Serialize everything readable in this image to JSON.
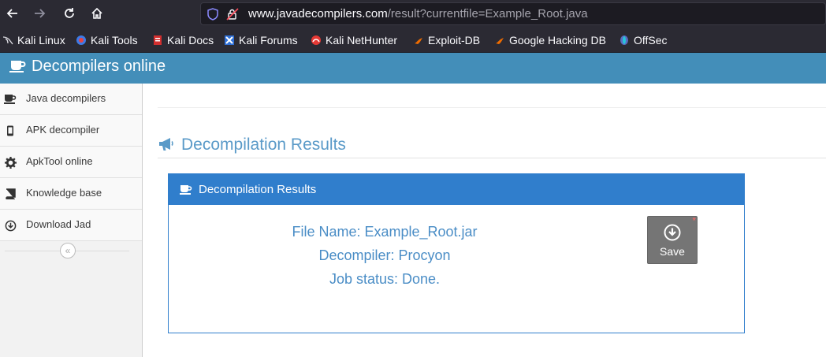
{
  "browser": {
    "url_host": "www.javadecompilers.com",
    "url_path": "/result?currentfile=Example_Root.java",
    "bookmarks": [
      {
        "label": "Kali Linux",
        "icon": "kali-dragon-icon"
      },
      {
        "label": "Kali Tools",
        "icon": "kali-tools-icon"
      },
      {
        "label": "Kali Docs",
        "icon": "kali-docs-icon"
      },
      {
        "label": "Kali Forums",
        "icon": "kali-forums-icon"
      },
      {
        "label": "Kali NetHunter",
        "icon": "nethunter-icon"
      },
      {
        "label": "Exploit-DB",
        "icon": "exploit-db-icon"
      },
      {
        "label": "Google Hacking DB",
        "icon": "ghdb-icon"
      },
      {
        "label": "OffSec",
        "icon": "offsec-icon"
      }
    ]
  },
  "site": {
    "title": "Decompilers online",
    "logo_icon": "coffee-cup-icon"
  },
  "sidebar": {
    "items": [
      {
        "label": "Java decompilers",
        "icon": "coffee-cup-icon"
      },
      {
        "label": "APK decompiler",
        "icon": "mobile-phone-icon"
      },
      {
        "label": "ApkTool online",
        "icon": "gear-icon"
      },
      {
        "label": "Knowledge base",
        "icon": "book-icon"
      },
      {
        "label": "Download Jad",
        "icon": "download-circle-icon"
      }
    ],
    "collapse_icon": "double-chevron-left-icon"
  },
  "main": {
    "heading": "Decompilation Results",
    "heading_icon": "bullhorn-icon",
    "widget": {
      "title": "Decompilation Results",
      "lines": [
        "File Name: Example_Root.jar",
        "Decompiler: Procyon",
        "Job status: Done."
      ],
      "save_label": "Save",
      "save_badge": "*"
    }
  },
  "colors": {
    "header_blue": "#438eb9",
    "widget_blue": "#307ecc",
    "text_blue": "#4a8dc6",
    "browser_dark": "#2b2a33"
  }
}
